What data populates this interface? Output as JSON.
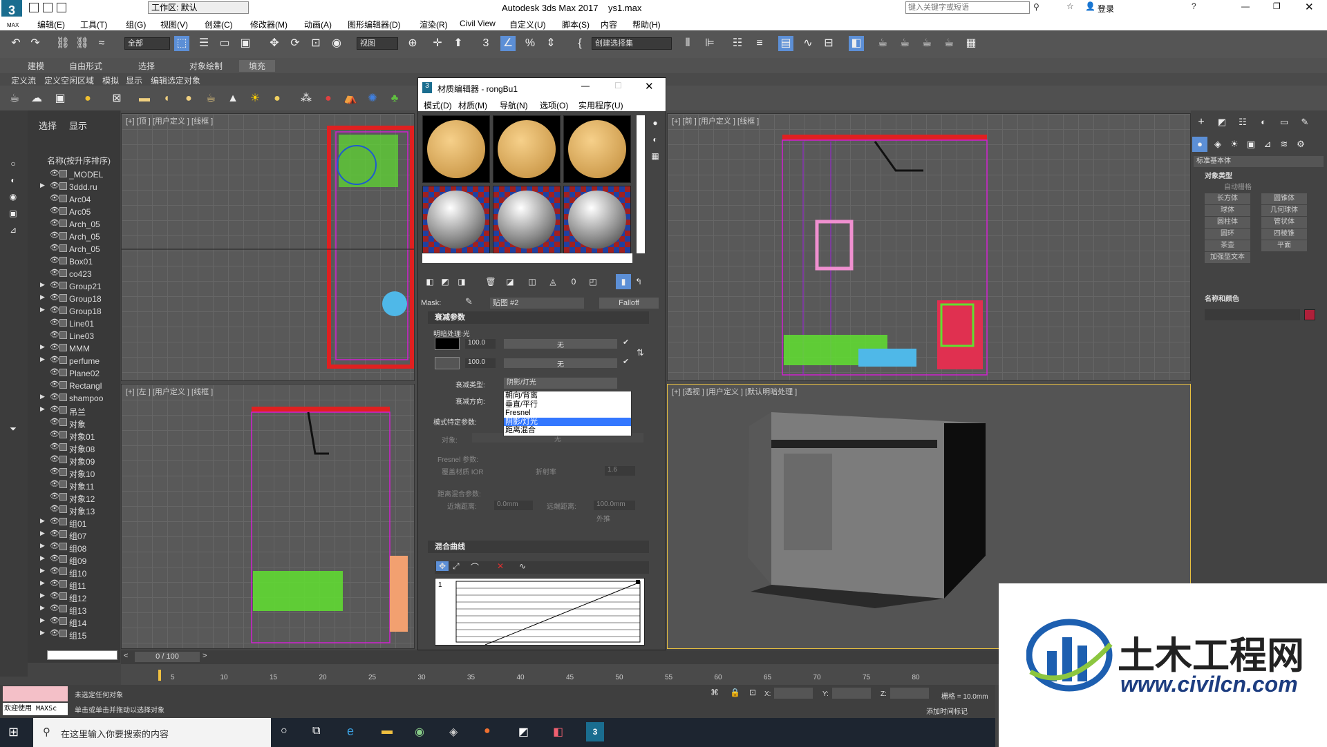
{
  "titlebar": {
    "workspace_label": "工作区: 默认",
    "app_title": "Autodesk 3ds Max 2017",
    "file_name": "ys1.max",
    "search_placeholder": "键入关键字或短语",
    "login_label": "登录"
  },
  "menubar": [
    "编辑(E)",
    "工具(T)",
    "组(G)",
    "视图(V)",
    "创建(C)",
    "修改器(M)",
    "动画(A)",
    "图形编辑器(D)",
    "渲染(R)",
    "Civil View",
    "自定义(U)",
    "脚本(S)",
    "内容",
    "帮助(H)"
  ],
  "toolbar": {
    "selection_filter": "全部",
    "ref_coord": "视图",
    "named_selection": "创建选择集"
  },
  "ribbon": {
    "tabs": [
      "建模",
      "自由形式",
      "选择",
      "对象绘制",
      "填充"
    ]
  },
  "ribbon2": [
    "定义流",
    "定义空闲区域",
    "模拟",
    "显示",
    "编辑选定对象"
  ],
  "scene_explorer": {
    "tab_select": "选择",
    "tab_display": "显示",
    "header": "名称(按升序排序)",
    "items": [
      "_MODEL",
      "3ddd.ru",
      "Arc04",
      "Arc05",
      "Arch_05",
      "Arch_05",
      "Arch_05",
      "Box01",
      "co423",
      "Group21",
      "Group18",
      "Group18",
      "Line01",
      "Line03",
      "MMM",
      "perfume",
      "Plane02",
      "Rectangl",
      "shampoo",
      "吊兰",
      "对象",
      "对象01",
      "对象08",
      "对象09",
      "对象10",
      "对象11",
      "对象12",
      "对象13",
      "组01",
      "组07",
      "组08",
      "组09",
      "组10",
      "组11",
      "组12",
      "组13",
      "组14",
      "组15"
    ]
  },
  "viewports": {
    "top": "[+] [顶 ] [用户定义 ] [线框 ]",
    "front": "[+] [前 ] [用户定义 ] [线框 ]",
    "left": "[+] [左 ] [用户定义 ] [线框 ]",
    "perspective": "[+] [透视 ] [用户定义 ] [默认明暗处理 ]"
  },
  "material_editor": {
    "title": "材质编辑器 - rongBu1",
    "menus": [
      "模式(D)",
      "材质(M)",
      "导航(N)",
      "选项(O)",
      "实用程序(U)"
    ],
    "mask_label": "Mask:",
    "map_name": "贴图 #2",
    "map_type": "Falloff",
    "rollout_falloff": "衰减参数",
    "front_side": "明暗处理:光",
    "val1": "100.0",
    "val2": "100.0",
    "none1": "无",
    "none2": "无",
    "falloff_type_label": "衰减类型:",
    "falloff_type_value": "阴影/灯光",
    "falloff_dir_label": "衰减方向:",
    "mode_params": "模式特定参数:",
    "object_label": "对象:",
    "object_value": "无",
    "fresnel_params": "Fresnel 参数:",
    "override_ior": "覆盖材质 IOR",
    "ior_label": "折射率",
    "ior_value": "1.6",
    "dist_blend": "距离混合参数:",
    "near_label": "近端距离:",
    "near_value": "0.0mm",
    "far_label": "远端距离:",
    "far_value": "100.0mm",
    "extrapolate": "外推",
    "rollout_curve": "混合曲线",
    "curve_num": "1",
    "dropdown_options": [
      "朝向/背离",
      "垂直/平行",
      "Fresnel",
      "阴影/灯光",
      "距离混合"
    ],
    "dropdown_selected_index": 3
  },
  "command_panel": {
    "category": "标准基本体",
    "object_type": "对象类型",
    "autogrid": "自动栅格",
    "buttons": [
      "长方体",
      "圆锥体",
      "球体",
      "几何球体",
      "圆柱体",
      "管状体",
      "圆环",
      "四棱锥",
      "茶壶",
      "平面",
      "加强型文本"
    ],
    "name_color": "名称和颜色"
  },
  "timeline": {
    "frame": "0 / 100",
    "ticks": [
      "5",
      "10",
      "15",
      "20",
      "25",
      "30",
      "35",
      "40",
      "45",
      "50",
      "55",
      "60",
      "65",
      "70",
      "75",
      "80"
    ]
  },
  "status": {
    "listener": "欢迎使用 MAXSc",
    "msg1": "未选定任何对象",
    "msg2": "单击或单击并拖动以选择对象",
    "x_label": "X:",
    "y_label": "Y:",
    "z_label": "Z:",
    "grid": "栅格 = 10.0mm",
    "add_tag": "添加时间标记"
  },
  "taskbar": {
    "search_placeholder": "在这里输入你要搜索的内容"
  },
  "watermark": {
    "cn": "土木工程网",
    "url": "www.civilcn.com"
  },
  "colors": {
    "magenta": "#d020d0",
    "red": "#e02020",
    "green": "#60e030",
    "highlight": "#3377ff"
  }
}
